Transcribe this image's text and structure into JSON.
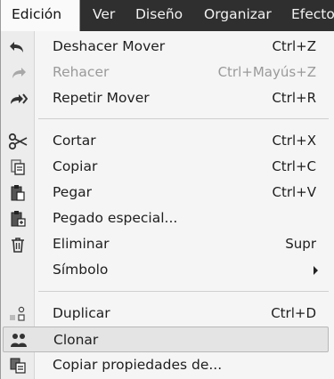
{
  "menubar": {
    "items": [
      {
        "label": "Edición",
        "mnemonic": "E"
      },
      {
        "label": "Ver",
        "mnemonic": "V"
      },
      {
        "label": "Diseño",
        "mnemonic": "D"
      },
      {
        "label": "Organizar",
        "mnemonic": "O"
      },
      {
        "label": "Efecto",
        "mnemonic": "c"
      }
    ]
  },
  "menu": {
    "items": [
      {
        "label": "Deshacer Mover",
        "shortcut": "Ctrl+Z",
        "icon": "undo-icon",
        "mnemonic": "D"
      },
      {
        "label": "Rehacer",
        "shortcut": "Ctrl+Mayús+Z",
        "icon": "redo-icon",
        "mnemonic": "h",
        "disabled": true
      },
      {
        "label": "Repetir Mover",
        "shortcut": "Ctrl+R",
        "icon": "repeat-icon",
        "mnemonic": "e"
      },
      {
        "label": "Cortar",
        "shortcut": "Ctrl+X",
        "icon": "scissors-icon",
        "mnemonic": "t"
      },
      {
        "label": "Copiar",
        "shortcut": "Ctrl+C",
        "icon": "copy-icon",
        "mnemonic": "C"
      },
      {
        "label": "Pegar",
        "shortcut": "Ctrl+V",
        "icon": "paste-icon",
        "mnemonic": "P"
      },
      {
        "label": "Pegado especial...",
        "shortcut": "",
        "icon": "paste-special-icon",
        "mnemonic": "l"
      },
      {
        "label": "Eliminar",
        "shortcut": "Supr",
        "icon": "trash-icon",
        "mnemonic": "m"
      },
      {
        "label": "Símbolo",
        "shortcut": "",
        "icon": "",
        "mnemonic": "l",
        "submenu": true
      },
      {
        "label": "Duplicar",
        "shortcut": "Ctrl+D",
        "icon": "duplicate-icon",
        "mnemonic": "r"
      },
      {
        "label": "Clonar",
        "shortcut": "",
        "icon": "clone-icon",
        "mnemonic": "n",
        "highlighted": true
      },
      {
        "label": "Copiar propiedades de...",
        "shortcut": "",
        "icon": "copy-properties-icon",
        "mnemonic": "i"
      }
    ]
  },
  "colors": {
    "menubar_bg": "#2f2f2f",
    "menu_bg": "#f5f5f5",
    "highlight_bg": "#e4e4e4",
    "disabled_text": "#9a9a9a"
  }
}
